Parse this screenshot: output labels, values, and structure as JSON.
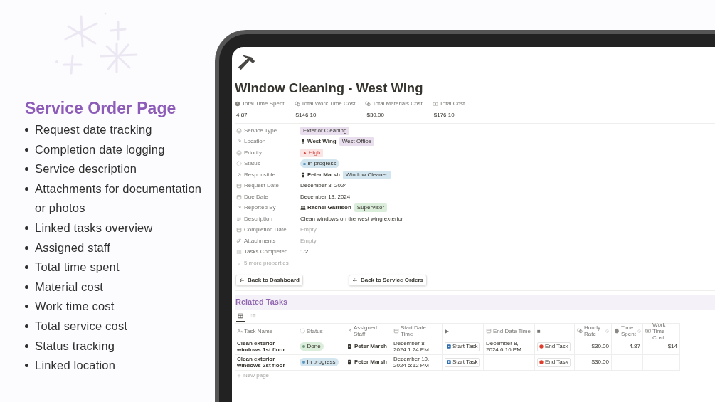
{
  "promo": {
    "title": "Service Order Page",
    "features": [
      "Request date tracking",
      "Completion date logging",
      "Service description",
      "Attachments for documentation or photos",
      "Linked tasks overview",
      "Assigned staff",
      "Total time spent",
      "Material cost",
      "Work time cost",
      "Total service cost",
      "Status tracking",
      "Linked location"
    ]
  },
  "page": {
    "title": "Window Cleaning - West Wing",
    "stats": [
      {
        "label": "Total Time Spent",
        "value": "4.87"
      },
      {
        "label": "Total Work Time Cost",
        "value": "$146.10"
      },
      {
        "label": "Total Materials Cost",
        "value": "$30.00"
      },
      {
        "label": "Total Cost",
        "value": "$176.10"
      }
    ],
    "properties": [
      {
        "label": "Service Type",
        "kind": "tag",
        "value": "Exterior Cleaning",
        "color": "#e8deee"
      },
      {
        "label": "Location",
        "kind": "relation",
        "value": "West Wing",
        "tag": "West Office",
        "color": "#e8deee"
      },
      {
        "label": "Priority",
        "kind": "priority",
        "value": "High",
        "color": "#fbe4e4"
      },
      {
        "label": "Status",
        "kind": "status",
        "value": "In progress",
        "color": "#d3e5ef"
      },
      {
        "label": "Responsible",
        "kind": "relation",
        "value": "Peter Marsh",
        "tag": "Window Cleaner",
        "color": "#d3e5ef"
      },
      {
        "label": "Request Date",
        "kind": "text",
        "value": "December 3, 2024"
      },
      {
        "label": "Due Date",
        "kind": "text",
        "value": "December 13, 2024"
      },
      {
        "label": "Reported By",
        "kind": "relation",
        "value": "Rachel Garrison",
        "tag": "Supervisor",
        "color": "#dbeddb"
      },
      {
        "label": "Description",
        "kind": "text",
        "value": "Clean windows on the west wing exterior"
      },
      {
        "label": "Completion Date",
        "kind": "empty",
        "value": "Empty"
      },
      {
        "label": "Attachments",
        "kind": "empty",
        "value": "Empty"
      },
      {
        "label": "Tasks Completed",
        "kind": "text",
        "value": "1/2"
      }
    ],
    "more_properties": "5 more properties",
    "buttons": [
      "Back to Dashboard",
      "Back to Service Orders"
    ],
    "section_title": "Related Tasks",
    "views": [
      {
        "selected": true
      },
      {
        "selected": false
      }
    ],
    "table": {
      "columns": [
        "Task Name",
        "Status",
        "Assigned Staff",
        "Start Date Time",
        "▶",
        "End Date Time",
        "■",
        "Hourly Rate",
        "Time Spent",
        "Work Time Cost"
      ],
      "rows": [
        {
          "task": "Clean exterior windows 1st floor",
          "status": {
            "label": "Done",
            "color": "#dbeddb"
          },
          "staff": "Peter Marsh",
          "start": "December 8, 2024 1:24 PM",
          "start_button": "Start Task",
          "end": "December 8, 2024 6:16 PM",
          "end_button": "End Task",
          "rate": "$30.00",
          "time": "4.87",
          "cost": "$14"
        },
        {
          "task": "Clean exterior windows 2st floor",
          "status": {
            "label": "In progress",
            "color": "#d3e5ef"
          },
          "staff": "Peter Marsh",
          "start": "December 10, 2024 5:12 PM",
          "start_button": "Start Task",
          "end": "",
          "end_button": "End Task",
          "rate": "$30.00",
          "time": "",
          "cost": ""
        }
      ],
      "new_page": "New page"
    }
  }
}
